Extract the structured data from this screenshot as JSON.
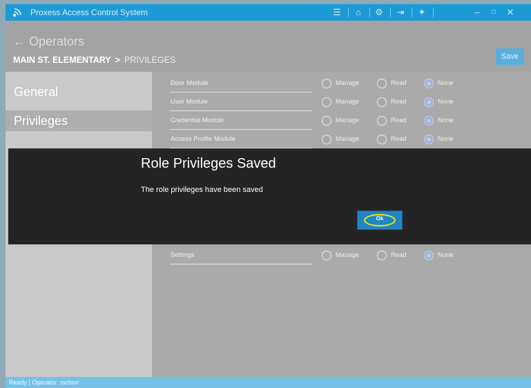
{
  "window": {
    "title": "Proxess Access Control System"
  },
  "header": {
    "back_label": "← Operators",
    "org_name": "MAIN ST. ELEMENTARY",
    "separator": ">",
    "current_page": "PRIVILEGES",
    "save_label": "Save"
  },
  "sidebar": {
    "items": [
      {
        "label": "General"
      },
      {
        "label": "Privileges"
      }
    ]
  },
  "options": {
    "manage": "Manage",
    "read": "Read",
    "none": "None"
  },
  "privileges": [
    {
      "module": "Door Module",
      "selected": "None"
    },
    {
      "module": "User Module",
      "selected": "None"
    },
    {
      "module": "Credential Module",
      "selected": "None"
    },
    {
      "module": "Access Profile Module",
      "selected": "None"
    },
    {
      "module": "Settings",
      "selected": "None"
    }
  ],
  "dialog": {
    "title": "Role Privileges Saved",
    "message": "The role privileges have been saved",
    "ok_label": "Ok"
  },
  "status": {
    "text": "Ready | Operator: rschorr"
  },
  "colors": {
    "accent": "#1c9ad6",
    "overlay": "#242424",
    "focus_ring": "#f5e30e"
  }
}
